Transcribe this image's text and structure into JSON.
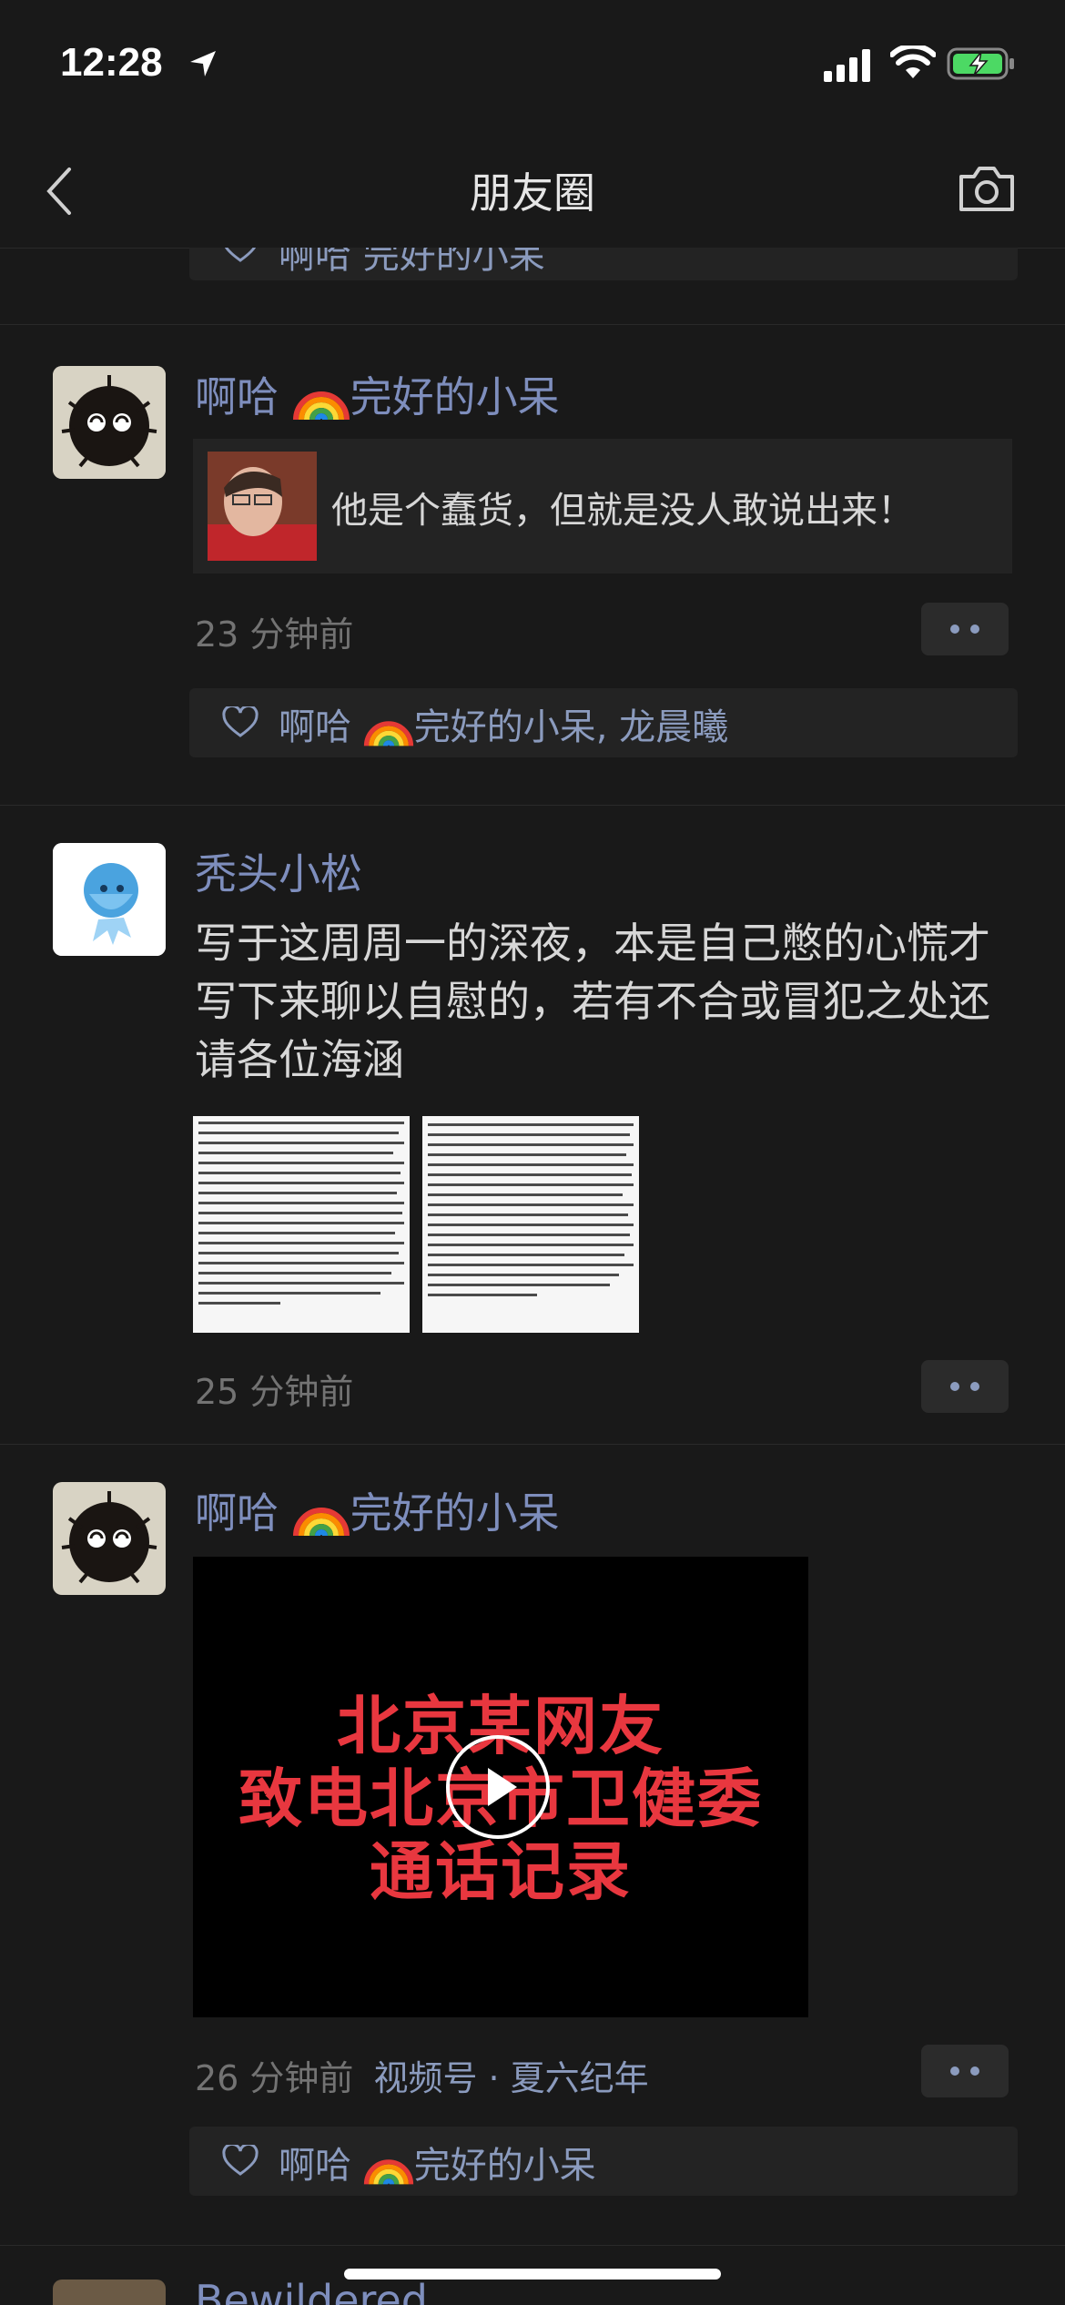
{
  "status_bar": {
    "time": "12:28"
  },
  "nav": {
    "title": "朋友圈"
  },
  "top_partial_likes": "啊哈 完好的小呆",
  "posts": [
    {
      "author": "啊哈",
      "author_suffix": "完好的小呆",
      "share_text": "他是个蠢货，但就是没人敢说出来！",
      "time": "23 分钟前",
      "likes": "啊哈",
      "likes_suffix": "完好的小呆, 龙晨曦"
    },
    {
      "author": "秃头小松",
      "text": "写于这周周一的深夜，本是自己憋的心慌才写下来聊以自慰的，若有不合或冒犯之处还请各位海涵",
      "time": "25 分钟前"
    },
    {
      "author": "啊哈",
      "author_suffix": "完好的小呆",
      "video_lines": [
        "北京某网友",
        "致电北京市卫健委",
        "通话记录"
      ],
      "time": "26 分钟前",
      "source": "视频号 · 夏六纪年",
      "likes": "啊哈",
      "likes_suffix": "完好的小呆"
    }
  ],
  "bottom_partial_name": "Bewildered"
}
